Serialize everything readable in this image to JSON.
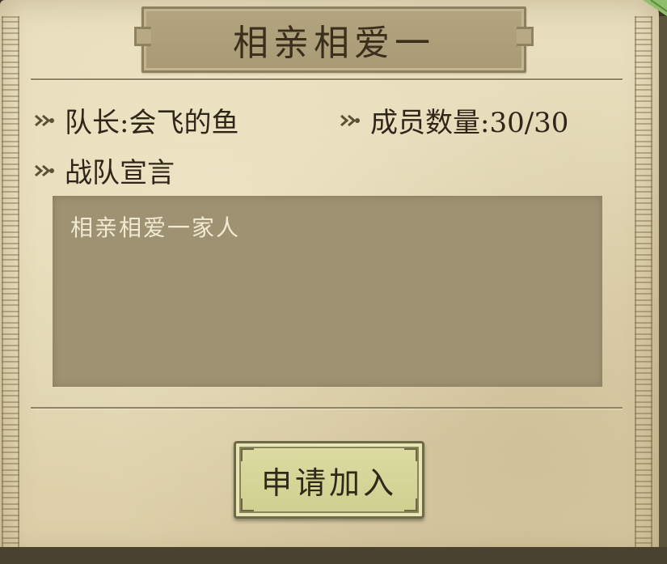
{
  "team": {
    "name": "相亲相爱一",
    "leader_label": "队长:会飞的鱼",
    "members_label": "成员数量:30/30",
    "manifesto_label": "战队宣言",
    "manifesto_text": "相亲相爱一家人"
  },
  "actions": {
    "join_label": "申请加入"
  },
  "icons": {
    "bullet": "double-chevron-right-icon"
  },
  "colors": {
    "parchment": "#e2d6b2",
    "plaque": "#a89a74",
    "manifesto_box": "#9f9273",
    "button": "#d3d396",
    "text_dark": "#2f2619",
    "text_light": "#f1ead2"
  }
}
